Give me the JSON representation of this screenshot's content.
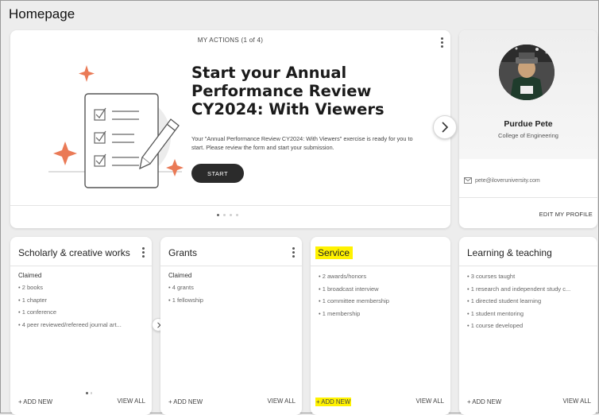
{
  "page": {
    "title": "Homepage"
  },
  "actions": {
    "header": "MY ACTIONS (1 of 4)",
    "headline": "Start your Annual Performance Review CY2024: With Viewers",
    "description": "Your \"Annual Performance Review CY2024: With Viewers\" exercise is ready for you to start. Please review the form and start your submission.",
    "start_label": "START",
    "next_icon": "chevron-right-icon",
    "carousel": {
      "total": 4,
      "active": 1
    }
  },
  "profile": {
    "name": "Purdue Pete",
    "college": "College of Engineering",
    "email": "pete@iloveruniversity.com",
    "edit_label": "EDIT MY PROFILE",
    "email_icon": "mail-icon"
  },
  "cards": [
    {
      "title": "Scholarly & creative works",
      "claimed": "Claimed",
      "items": [
        "2 books",
        "1 chapter",
        "1 conference",
        "4 peer reviewed/refereed journal art..."
      ],
      "add_label": "+ ADD NEW",
      "view_label": "VIEW ALL"
    },
    {
      "title": "Grants",
      "claimed": "Claimed",
      "items": [
        "4 grants",
        "1 fellowship"
      ],
      "add_label": "+ ADD NEW",
      "view_label": "VIEW ALL"
    },
    {
      "title": "Service",
      "items": [
        "2 awards/honors",
        "1 broadcast interview",
        "1 committee membership",
        "1 membership"
      ],
      "add_label": "+ ADD NEW",
      "view_label": "VIEW ALL",
      "highlight_color": "#fff200"
    },
    {
      "title": "Learning & teaching",
      "items": [
        "3 courses taught",
        "1 research and independent study c...",
        "1 directed student learning",
        "1 student mentoring",
        "1 course developed"
      ],
      "add_label": "+ ADD NEW",
      "view_label": "VIEW ALL"
    }
  ],
  "colors": {
    "accent_plus": "#ea7a56",
    "button_dark": "#2b2b2b",
    "highlight": "#fff200"
  }
}
